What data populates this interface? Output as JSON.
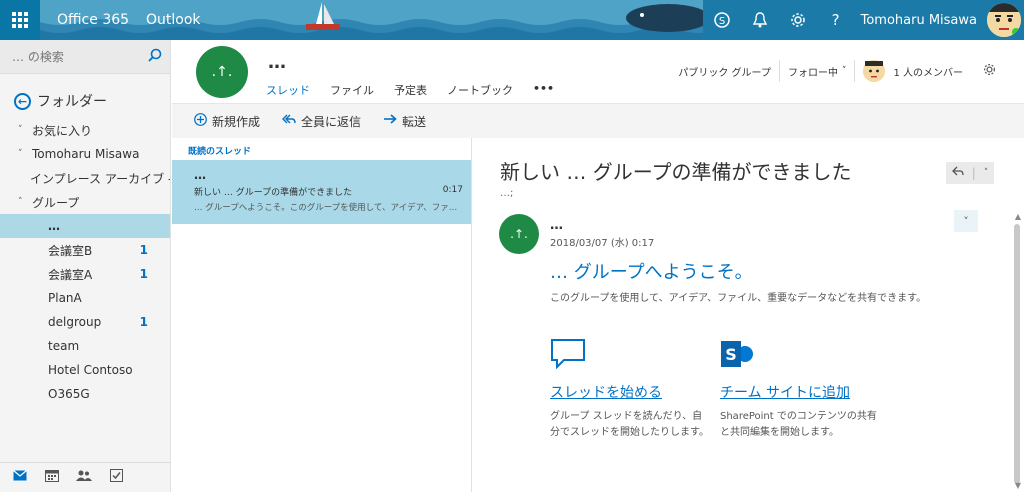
{
  "topbar": {
    "brand": "Office 365",
    "app": "Outlook",
    "user_name": "Tomoharu Misawa"
  },
  "leftnav": {
    "search_placeholder": "… の検索",
    "folders_label": "フォルダー",
    "items": [
      {
        "label": "お気に入り",
        "chevron": "˅"
      },
      {
        "label": "Tomoharu Misawa",
        "chevron": "˅"
      },
      {
        "label": "インプレース アーカイブ -Tomoharu Misawa",
        "chevron": ""
      },
      {
        "label": "グループ",
        "chevron": "˄"
      }
    ],
    "groups": [
      {
        "label": "…",
        "count": ""
      },
      {
        "label": "会議室B",
        "count": "1"
      },
      {
        "label": "会議室A",
        "count": "1"
      },
      {
        "label": "PlanA",
        "count": ""
      },
      {
        "label": "delgroup",
        "count": "1"
      },
      {
        "label": "team",
        "count": ""
      },
      {
        "label": "Hotel Contoso",
        "count": ""
      },
      {
        "label": "O365G",
        "count": ""
      }
    ]
  },
  "group_header": {
    "avatar_text": ".↑.",
    "name": "…",
    "tabs": [
      "スレッド",
      "ファイル",
      "予定表",
      "ノートブック",
      "•••"
    ],
    "privacy": "パブリック グループ",
    "follow": "フォロー中",
    "members": "1 人のメンバー"
  },
  "commands": {
    "new": "新規作成",
    "reply_all": "全員に返信",
    "forward": "転送"
  },
  "message_list": {
    "filter": "既読のスレッド",
    "items": [
      {
        "from": "…",
        "subject": "新しい … グループの準備ができました",
        "time": "0:17",
        "preview": "… グループへようこそ。このグループを使用して、アイデア、ファ…"
      }
    ]
  },
  "reading": {
    "subject": "新しい … グループの準備ができました",
    "recipients": "…;",
    "sender_avatar": ".↑.",
    "sender": "…",
    "date": "2018/03/07 (水) 0:17",
    "welcome": "… グループへようこそ。",
    "welcome_desc": "このグループを使用して、アイデア、ファイル、重要なデータなどを共有できます。",
    "cards": [
      {
        "title": "スレッドを始める",
        "desc": "グループ スレッドを読んだり、自分でスレッドを開始したりします。",
        "icon": "chat-bubble-icon"
      },
      {
        "title": "チーム サイトに追加",
        "desc": "SharePoint でのコンテンツの共有と共同編集を開始します。",
        "icon": "sharepoint-icon"
      }
    ]
  },
  "colors": {
    "accent": "#0072c6",
    "topbar": "#3a8fb7",
    "selected": "#a9d9e8",
    "group_avatar": "#1f8a45"
  }
}
